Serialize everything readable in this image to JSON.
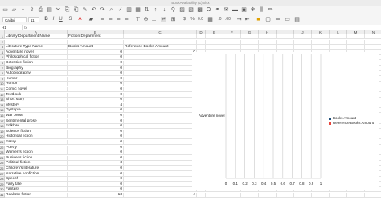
{
  "window": {
    "title": "BookAvailability (1).xlsx"
  },
  "toolbar": {
    "icons": [
      "new-icon",
      "open-icon",
      "save-icon",
      "export-icon",
      "print-icon",
      "pdf-icon",
      "cut-icon",
      "copy-icon",
      "paste-icon",
      "clone-icon",
      "undo-icon",
      "redo-icon",
      "find-icon",
      "spelling-icon",
      "row-icon",
      "col-icon",
      "sort-icon",
      "sort-asc-icon",
      "sort-desc-icon",
      "autofilter-icon",
      "image-icon",
      "chart-icon",
      "pivot-icon",
      "special-char-icon",
      "link-icon",
      "comment-icon",
      "header-icon",
      "define-print-icon",
      "freeze-icon",
      "split-icon",
      "show-draw-icon"
    ]
  },
  "fontbar": {
    "font_name": "Calibri",
    "font_size": "11"
  },
  "formula": {
    "cell_ref": "H1",
    "fx": "fx",
    "value": ""
  },
  "columns": [
    "A",
    "B",
    "C",
    "D",
    "E",
    "F",
    "G",
    "H",
    "I",
    "J",
    "K",
    "L",
    "M",
    "N"
  ],
  "rows": [
    {
      "n": "1",
      "a": "Library Department Name",
      "b": "Fiction Department",
      "c": ""
    },
    {
      "n": "2",
      "a": "",
      "b": "",
      "c": ""
    },
    {
      "n": "3",
      "a": "Literature Type Name",
      "b": "Books Amount",
      "c": "Reference Books Amount"
    },
    {
      "n": "4",
      "a": "Adventure novel",
      "b": "0",
      "c": "0"
    },
    {
      "n": "5",
      "a": "Philosophical fiction",
      "b": "0",
      "c": "0"
    },
    {
      "n": "6",
      "a": "Detective fiction",
      "b": "0",
      "c": "0"
    },
    {
      "n": "7",
      "a": "Biography",
      "b": "0",
      "c": "0"
    },
    {
      "n": "8",
      "a": "Autobiography",
      "b": "0",
      "c": "0"
    },
    {
      "n": "9",
      "a": "Humor",
      "b": "0",
      "c": "0"
    },
    {
      "n": "10",
      "a": "Humor",
      "b": "0",
      "c": "0"
    },
    {
      "n": "11",
      "a": "Comic novel",
      "b": "0",
      "c": "0"
    },
    {
      "n": "12",
      "a": "Textbook",
      "b": "0",
      "c": "0"
    },
    {
      "n": "13",
      "a": "Short story",
      "b": "0",
      "c": "0"
    },
    {
      "n": "14",
      "a": "Mystery",
      "b": "4",
      "c": "1"
    },
    {
      "n": "15",
      "a": "Dystopia",
      "b": "0",
      "c": "0"
    },
    {
      "n": "16",
      "a": "War prose",
      "b": "0",
      "c": "0"
    },
    {
      "n": "17",
      "a": "Sentimental prose",
      "b": "0",
      "c": "0"
    },
    {
      "n": "18",
      "a": "Folklore",
      "b": "0",
      "c": "0"
    },
    {
      "n": "19",
      "a": "Science fiction",
      "b": "0",
      "c": "0"
    },
    {
      "n": "20",
      "a": "Historical fiction",
      "b": "0",
      "c": "0"
    },
    {
      "n": "21",
      "a": "Essay",
      "b": "0",
      "c": "0"
    },
    {
      "n": "22",
      "a": "Poetry",
      "b": "0",
      "c": "0"
    },
    {
      "n": "23",
      "a": "Women's fiction",
      "b": "0",
      "c": "0"
    },
    {
      "n": "24",
      "a": "Business fiction",
      "b": "0",
      "c": "0"
    },
    {
      "n": "25",
      "a": "Political fiction",
      "b": "3",
      "c": "1"
    },
    {
      "n": "26",
      "a": "Children's literature",
      "b": "0",
      "c": "0"
    },
    {
      "n": "27",
      "a": "Narrative nonfiction",
      "b": "0",
      "c": "0"
    },
    {
      "n": "28",
      "a": "Speech",
      "b": "0",
      "c": "0"
    },
    {
      "n": "29",
      "a": "Fairy tale",
      "b": "0",
      "c": "0"
    },
    {
      "n": "30",
      "a": "Fantasy",
      "b": "0",
      "c": "0"
    },
    {
      "n": "31",
      "a": "Realistic fiction",
      "b": "13",
      "c": "4"
    }
  ],
  "chart": {
    "category_label": "Adventure novel",
    "legend": [
      {
        "name": "Books Amount",
        "color": "#1f4e79"
      },
      {
        "name": "Reference Books Amount",
        "color": "#e8453c"
      }
    ],
    "x_ticks": [
      "0",
      "0.1",
      "0.2",
      "0.3",
      "0.4",
      "0.5",
      "0.6",
      "0.7",
      "0.8",
      "0.9",
      "1"
    ]
  },
  "chart_data": {
    "type": "bar",
    "orientation": "horizontal",
    "categories": [
      "Adventure novel"
    ],
    "series": [
      {
        "name": "Books Amount",
        "values": [
          0
        ]
      },
      {
        "name": "Reference Books Amount",
        "values": [
          0
        ]
      }
    ],
    "xlim": [
      0,
      1
    ],
    "x_ticks": [
      0,
      0.1,
      0.2,
      0.3,
      0.4,
      0.5,
      0.6,
      0.7,
      0.8,
      0.9,
      1
    ],
    "grid": true,
    "legend_position": "right"
  }
}
